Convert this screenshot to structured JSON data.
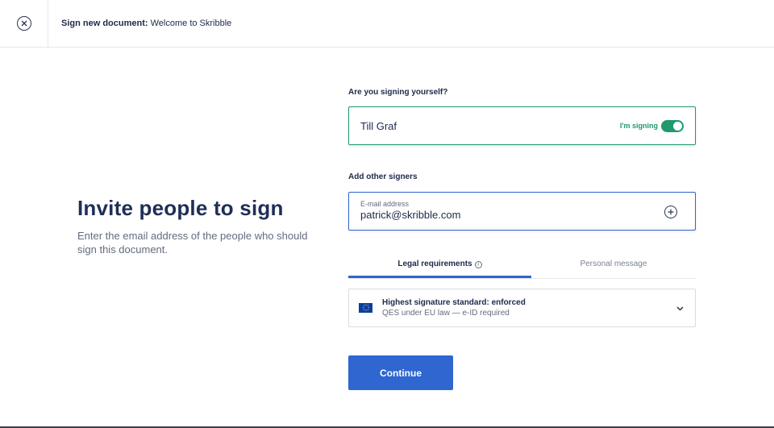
{
  "header": {
    "title_bold": "Sign new document:",
    "title_rest": "Welcome to Skribble"
  },
  "intro": {
    "heading": "Invite people to sign",
    "description": "Enter the email address of the people who should sign this document."
  },
  "self_signing": {
    "label": "Are you signing yourself?",
    "name": "Till Graf",
    "toggle_label": "I'm signing",
    "toggle_on": true
  },
  "other_signers": {
    "label": "Add other signers",
    "email_label": "E-mail address",
    "email_value": "patrick@skribble.com"
  },
  "tabs": [
    {
      "label": "Legal requirements",
      "active": true
    },
    {
      "label": "Personal message",
      "active": false
    }
  ],
  "legal": {
    "title": "Highest signature standard: enforced",
    "subtitle": "QES under EU law — e-ID required"
  },
  "actions": {
    "continue_label": "Continue"
  },
  "colors": {
    "accent_blue": "#2f66d0",
    "success_green": "#1e9a6c",
    "heading_navy": "#1f2f57"
  }
}
